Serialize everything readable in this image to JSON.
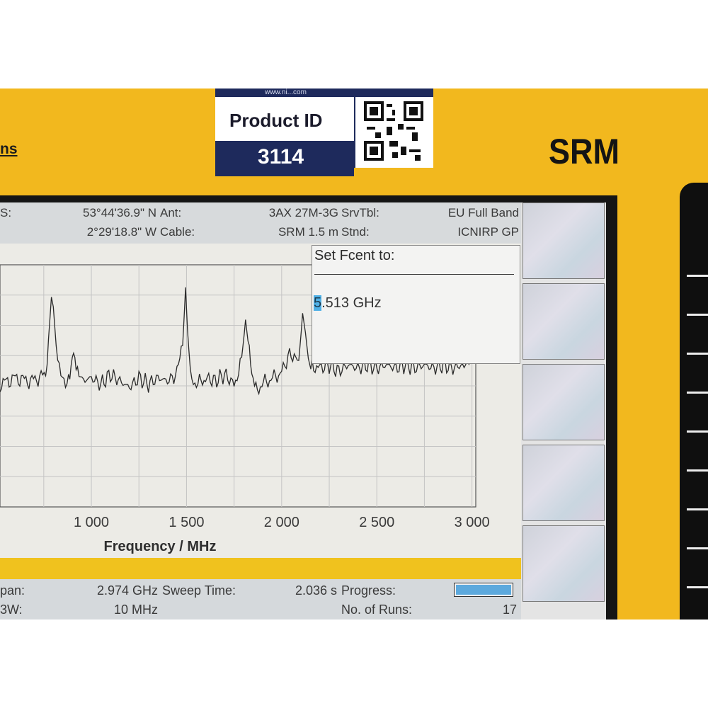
{
  "device": {
    "brand_fragment": "ns",
    "model": "SRM"
  },
  "asset_label": {
    "url_fragment": "www.ni...com",
    "title": "Product ID",
    "number": "3114",
    "qr_icon": "qr-code-icon"
  },
  "info_bar": {
    "gps_label": "S:",
    "lat": "53°44'36.9\" N",
    "lon": "2°29'18.8\" W",
    "ant_label": "Ant:",
    "ant_value": "3AX 27M-3G",
    "cable_label": "Cable:",
    "cable_value": "SRM 1.5 m",
    "srvtbl_label": "SrvTbl:",
    "srvtbl_value": "EU Full Band",
    "stnd_label": "Stnd:",
    "stnd_value": "ICNIRP GP"
  },
  "dialog": {
    "title": "Set Fcent to:",
    "cursor_digit": "5",
    "value_rest": ".513 GHz"
  },
  "chart_data": {
    "type": "line",
    "xlabel": "Frequency / MHz",
    "ylabel": "",
    "tick_labels": [
      "1 000",
      "1 500",
      "2 000",
      "2 500",
      "3 000"
    ],
    "xlim": [
      520,
      3020
    ],
    "grid": true,
    "series": [
      {
        "values_note": "",
        "x": [
          520,
          600,
          680,
          760,
          775,
          790,
          800,
          815,
          840,
          880,
          900,
          920,
          950,
          1000,
          1050,
          1100,
          1150,
          1200,
          1250,
          1300,
          1350,
          1400,
          1450,
          1480,
          1495,
          1505,
          1520,
          1560,
          1600,
          1650,
          1700,
          1750,
          1790,
          1810,
          1830,
          1850,
          1880,
          1920,
          1960,
          2000,
          2050,
          2090,
          2110,
          2125,
          2140,
          2160,
          2200,
          2250,
          2300,
          2350,
          2400,
          2450,
          2500,
          2550,
          2600,
          2650,
          2700,
          2750,
          2800,
          2850,
          2900,
          2950,
          2985
        ],
        "y": [
          -72,
          -70,
          -71,
          -69,
          -58,
          -45,
          -48,
          -60,
          -70,
          -71,
          -63,
          -66,
          -71,
          -70,
          -72,
          -69,
          -71,
          -73,
          -70,
          -72,
          -70,
          -71,
          -69,
          -60,
          -42,
          -55,
          -70,
          -72,
          -70,
          -71,
          -69,
          -72,
          -65,
          -52,
          -62,
          -70,
          -73,
          -71,
          -70,
          -68,
          -62,
          -66,
          -50,
          -56,
          -64,
          -66,
          -67,
          -66,
          -68,
          -66,
          -67,
          -66,
          -67,
          -66,
          -67,
          -66,
          -67,
          -66,
          -67,
          -66,
          -67,
          -66,
          -66
        ],
        "ylim": [
          -110,
          -35
        ]
      }
    ]
  },
  "status_bar": {
    "span_label": "pan:",
    "span_value": "2.974 GHz",
    "rbw_label": "3W:",
    "rbw_value": "10 MHz",
    "sweep_label": "Sweep Time:",
    "sweep_value": "2.036 s",
    "progress_label": "Progress:",
    "progress_value": 1.0,
    "runs_label": "No. of Runs:",
    "runs_value": "17"
  },
  "colors": {
    "housing": "#f2b81e",
    "accent": "#5ca9dd",
    "label_navy": "#1e2a5c"
  }
}
